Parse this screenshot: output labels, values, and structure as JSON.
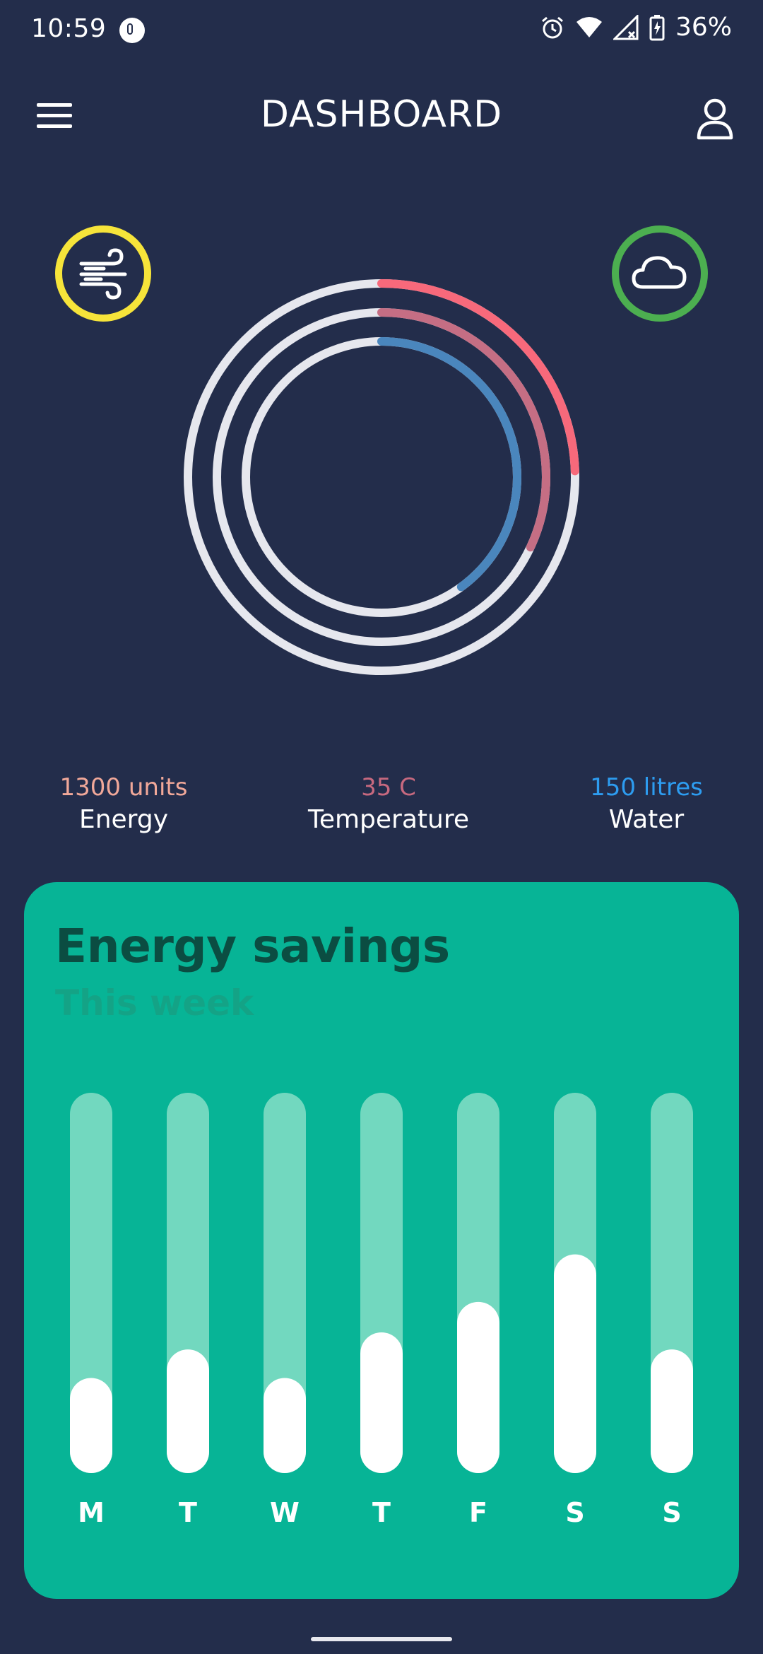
{
  "status_bar": {
    "time": "10:59",
    "battery": "36%"
  },
  "app_bar": {
    "title": "DASHBOARD"
  },
  "icons": {
    "menu": "menu-icon",
    "profile": "user-icon",
    "wind": "wind-icon",
    "cloud": "cloud-icon"
  },
  "colors": {
    "background": "#232d4b",
    "energy": "#f1a899",
    "temperature": "#c7697f",
    "water": "#2d9cf0",
    "wind_ring": "#f6e43a",
    "cloud_ring": "#4caf50",
    "card": "#07b496"
  },
  "stats": {
    "energy": {
      "value": "1300 units",
      "label": "Energy"
    },
    "temperature": {
      "value": "35 C",
      "label": "Temperature"
    },
    "water": {
      "value": "150 litres",
      "label": "Water"
    }
  },
  "rings": [
    {
      "label": "Energy",
      "fraction": 0.245,
      "color": "#f7697b"
    },
    {
      "label": "Temperature",
      "fraction": 0.32,
      "color": "#c56e84"
    },
    {
      "label": "Water",
      "fraction": 0.4,
      "color": "#4a86bd"
    }
  ],
  "card": {
    "title": "Energy savings",
    "subtitle": "This week",
    "chart_data": {
      "type": "bar",
      "categories": [
        "M",
        "T",
        "W",
        "T",
        "F",
        "S",
        "S"
      ],
      "values": [
        0.25,
        0.325,
        0.25,
        0.37,
        0.45,
        0.575,
        0.325
      ],
      "ylim": [
        0,
        1
      ]
    }
  }
}
